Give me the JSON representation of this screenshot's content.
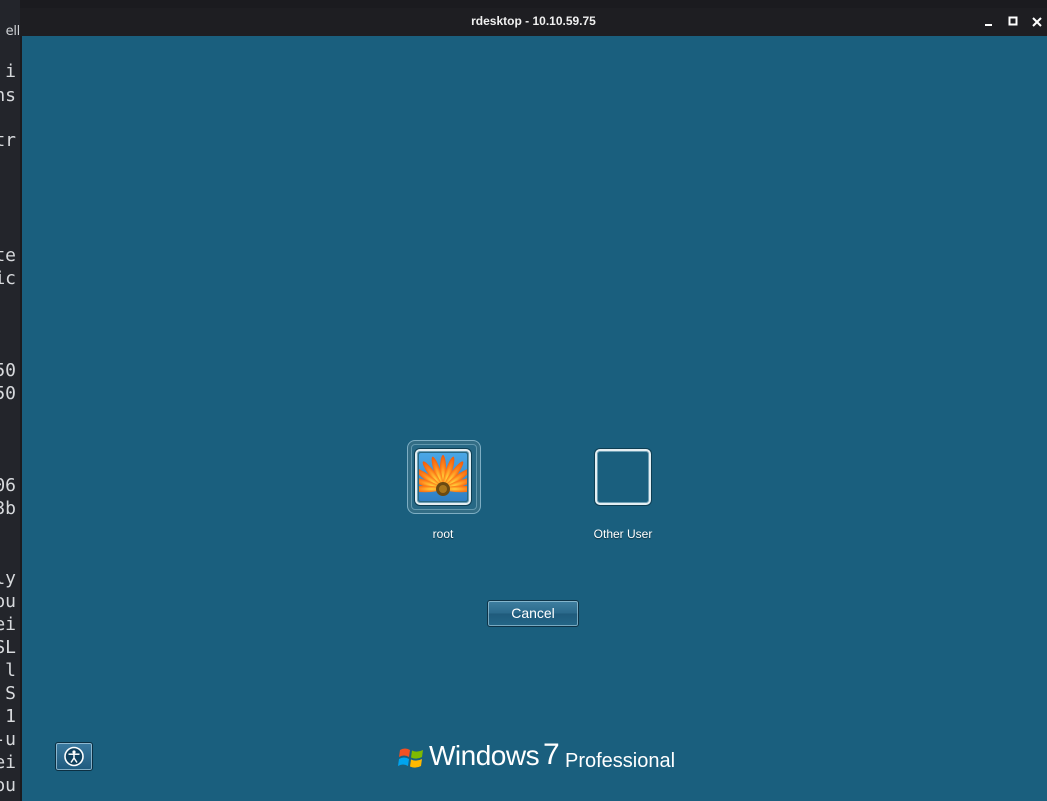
{
  "window": {
    "title": "rdesktop - 10.10.59.75"
  },
  "terminal": {
    "tab_label": "ell",
    "lines": [
      "i",
      "ns",
      "",
      "tr",
      "",
      "",
      "",
      "te",
      "ic",
      "",
      "",
      "",
      "50",
      "50",
      "",
      "",
      "",
      "06",
      "3b",
      "",
      "",
      "ly",
      "ou",
      "ei",
      "SL",
      "l",
      "S",
      "1",
      "-u",
      "ei",
      "ou"
    ]
  },
  "login": {
    "users": [
      {
        "name": "root",
        "selected": true
      },
      {
        "name": "Other User",
        "selected": false
      }
    ],
    "cancel_label": "Cancel"
  },
  "branding": {
    "product": "Windows",
    "version": "7",
    "edition": "Professional"
  },
  "colors": {
    "desktop_bg": "#1a5f7e",
    "titlebar_bg": "#1e1e22"
  }
}
